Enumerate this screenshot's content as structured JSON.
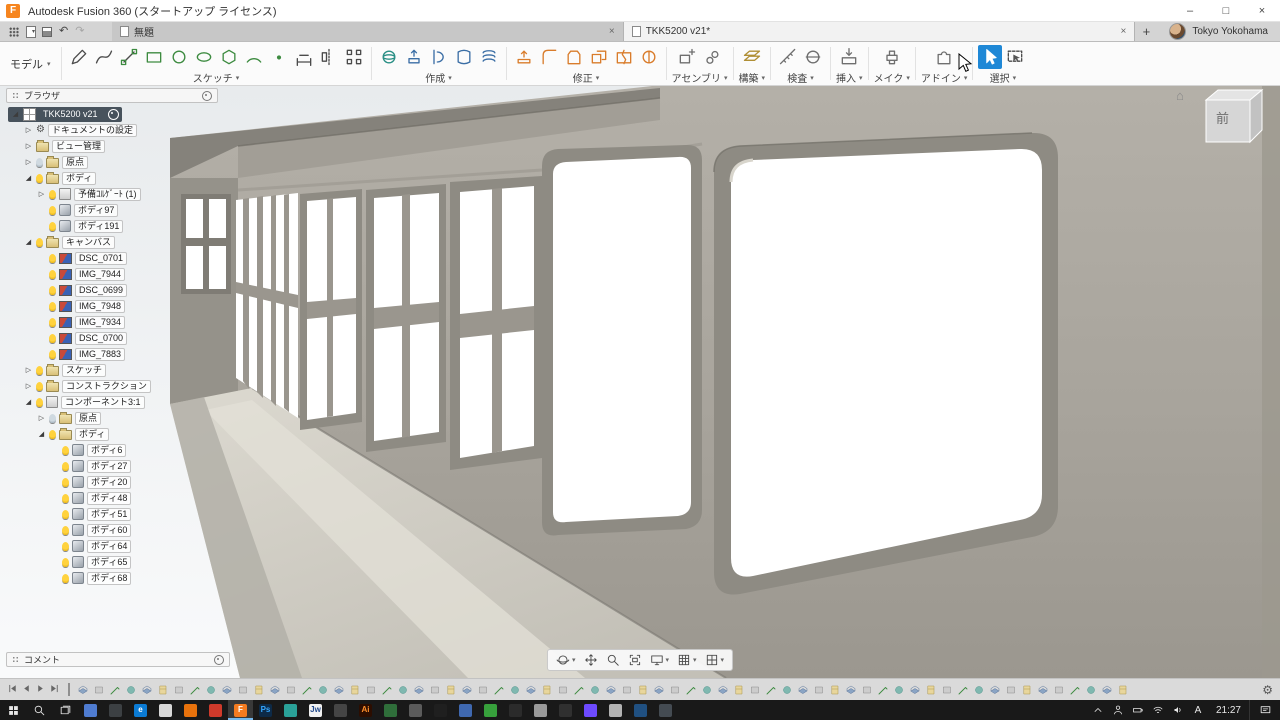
{
  "title_bar": {
    "title": "Autodesk Fusion 360 (スタートアップ ライセンス)",
    "window_controls": {
      "minimize": "–",
      "maximize": "□",
      "close": "×"
    }
  },
  "tab_bar": {
    "tabs": [
      {
        "label": "無題",
        "active": false
      },
      {
        "label": "TKK5200 v21*",
        "active": true
      }
    ],
    "new_tab_label": "+",
    "account_name": "Tokyo Yokohama"
  },
  "toolbar": {
    "workspace_label": "モデル",
    "groups": [
      {
        "label": "スケッチ",
        "icons": [
          "pencil",
          "spline",
          "line",
          "rect",
          "circle",
          "ellipse",
          "polygon",
          "arc",
          "point",
          "dimension",
          "mirror",
          "pattern"
        ]
      },
      {
        "label": "作成",
        "icons": [
          "form-sphere",
          "extrude",
          "revolve",
          "loft",
          "coil"
        ]
      },
      {
        "label": "修正",
        "icons": [
          "press-pull",
          "fillet",
          "shell",
          "combine",
          "split",
          "appearance"
        ]
      },
      {
        "label": "アセンブリ",
        "icons": [
          "new-component",
          "joint"
        ]
      },
      {
        "label": "構築",
        "icons": [
          "plane"
        ]
      },
      {
        "label": "検査",
        "icons": [
          "measure",
          "section"
        ]
      },
      {
        "label": "挿入",
        "icons": [
          "insert"
        ]
      },
      {
        "label": "メイク",
        "icons": [
          "make"
        ]
      },
      {
        "label": "アドイン",
        "icons": [
          "addins"
        ]
      },
      {
        "label": "選択",
        "icons": [
          "select",
          "select-window"
        ],
        "active_icon": 0
      }
    ]
  },
  "browser": {
    "header": "ブラウザ",
    "tree": [
      {
        "label": "TKK5200 v21",
        "level": 0,
        "type": "root",
        "exp": "open",
        "bulb": null,
        "selected": true
      },
      {
        "label": "ドキュメントの設定",
        "level": 1,
        "type": "settings",
        "exp": "closed",
        "bulb": null
      },
      {
        "label": "ビュー管理",
        "level": 1,
        "type": "folder",
        "exp": "closed",
        "bulb": null
      },
      {
        "label": "原点",
        "level": 1,
        "type": "folder",
        "exp": "closed",
        "bulb": "off"
      },
      {
        "label": "ボディ",
        "level": 1,
        "type": "folder",
        "exp": "open",
        "bulb": "on"
      },
      {
        "label": "予備ｺﾙｹﾞｰﾄ (1)",
        "level": 2,
        "type": "component",
        "exp": "closed",
        "bulb": "on"
      },
      {
        "label": "ボディ97",
        "level": 2,
        "type": "body",
        "exp": null,
        "bulb": "on"
      },
      {
        "label": "ボディ191",
        "level": 2,
        "type": "body",
        "exp": null,
        "bulb": "on"
      },
      {
        "label": "キャンバス",
        "level": 1,
        "type": "folder",
        "exp": "open",
        "bulb": "on"
      },
      {
        "label": "DSC_0701",
        "level": 2,
        "type": "canvas",
        "exp": null,
        "bulb": "on"
      },
      {
        "label": "IMG_7944",
        "level": 2,
        "type": "canvas",
        "exp": null,
        "bulb": "on"
      },
      {
        "label": "DSC_0699",
        "level": 2,
        "type": "canvas",
        "exp": null,
        "bulb": "on"
      },
      {
        "label": "IMG_7948",
        "level": 2,
        "type": "canvas",
        "exp": null,
        "bulb": "on"
      },
      {
        "label": "IMG_7934",
        "level": 2,
        "type": "canvas",
        "exp": null,
        "bulb": "on"
      },
      {
        "label": "DSC_0700",
        "level": 2,
        "type": "canvas",
        "exp": null,
        "bulb": "on"
      },
      {
        "label": "IMG_7883",
        "level": 2,
        "type": "canvas",
        "exp": null,
        "bulb": "on"
      },
      {
        "label": "スケッチ",
        "level": 1,
        "type": "folder",
        "exp": "closed",
        "bulb": "on"
      },
      {
        "label": "コンストラクション",
        "level": 1,
        "type": "folder",
        "exp": "closed",
        "bulb": "on"
      },
      {
        "label": "コンポーネント3:1",
        "level": 1,
        "type": "component",
        "exp": "open",
        "bulb": "on"
      },
      {
        "label": "原点",
        "level": 2,
        "type": "folder",
        "exp": "closed",
        "bulb": "off"
      },
      {
        "label": "ボディ",
        "level": 2,
        "type": "folder",
        "exp": "open",
        "bulb": "on"
      },
      {
        "label": "ボディ6",
        "level": 3,
        "type": "body",
        "exp": null,
        "bulb": "on"
      },
      {
        "label": "ボディ27",
        "level": 3,
        "type": "body",
        "exp": null,
        "bulb": "on"
      },
      {
        "label": "ボディ20",
        "level": 3,
        "type": "body",
        "exp": null,
        "bulb": "on"
      },
      {
        "label": "ボディ48",
        "level": 3,
        "type": "body",
        "exp": null,
        "bulb": "on"
      },
      {
        "label": "ボディ51",
        "level": 3,
        "type": "body",
        "exp": null,
        "bulb": "on"
      },
      {
        "label": "ボディ60",
        "level": 3,
        "type": "body",
        "exp": null,
        "bulb": "on"
      },
      {
        "label": "ボディ64",
        "level": 3,
        "type": "body",
        "exp": null,
        "bulb": "on"
      },
      {
        "label": "ボディ65",
        "level": 3,
        "type": "body",
        "exp": null,
        "bulb": "on"
      },
      {
        "label": "ボディ68",
        "level": 3,
        "type": "body",
        "exp": null,
        "bulb": "on"
      }
    ]
  },
  "comments": {
    "header": "コメント"
  },
  "viewport": {
    "viewcube_front_label": "前"
  },
  "navbar": {
    "items": [
      "orbit",
      "pan",
      "zoom",
      "fit",
      "display",
      "grid",
      "layout"
    ]
  },
  "timeline": {
    "icon_count": 66
  },
  "taskbar": {
    "ime": "A",
    "time": "21:27",
    "apps": [
      {
        "bg": "#4f7cd1"
      },
      {
        "bg": "#3c4043"
      },
      {
        "bg": "#0b7bd4",
        "label": "e"
      },
      {
        "bg": "#d8d8d8"
      },
      {
        "bg": "#e8720c"
      },
      {
        "bg": "#cf3a2b"
      },
      {
        "bg": "#f47b20",
        "label": "F",
        "active": true
      },
      {
        "bg": "#0d2a47",
        "label": "Ps",
        "label_color": "#35a7ff"
      },
      {
        "bg": "#2aa198"
      },
      {
        "bg": "#f0f0f0",
        "label": "Jw",
        "label_color": "#234a8c"
      },
      {
        "bg": "#454545"
      },
      {
        "bg": "#2c0d00",
        "label": "Ai",
        "label_color": "#ff8f2a"
      },
      {
        "bg": "#2f6e3a"
      },
      {
        "bg": "#5b5b5b"
      },
      {
        "bg": "#1f1f1f"
      },
      {
        "bg": "#3f68b0"
      },
      {
        "bg": "#37a03c"
      },
      {
        "bg": "#2b2b2b"
      },
      {
        "bg": "#9a9a9a"
      },
      {
        "bg": "#303030"
      },
      {
        "bg": "#6d4aff"
      },
      {
        "bg": "#b3b3b3"
      },
      {
        "bg": "#205081"
      },
      {
        "bg": "#444b52"
      }
    ]
  }
}
